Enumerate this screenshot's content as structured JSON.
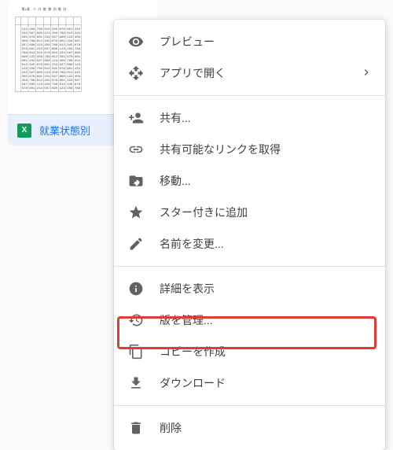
{
  "file": {
    "name": "就業状態別",
    "icon_label": "X",
    "thumb_title": "第1表　人 口 推 移 別 推 計"
  },
  "menu": {
    "preview": "プレビュー",
    "open_with": "アプリで開く",
    "share": "共有...",
    "get_link": "共有可能なリンクを取得",
    "move": "移動...",
    "star": "スター付きに追加",
    "rename": "名前を変更...",
    "details": "詳細を表示",
    "versions": "版を管理...",
    "make_copy": "コピーを作成",
    "download": "ダウンロード",
    "delete": "削除"
  }
}
